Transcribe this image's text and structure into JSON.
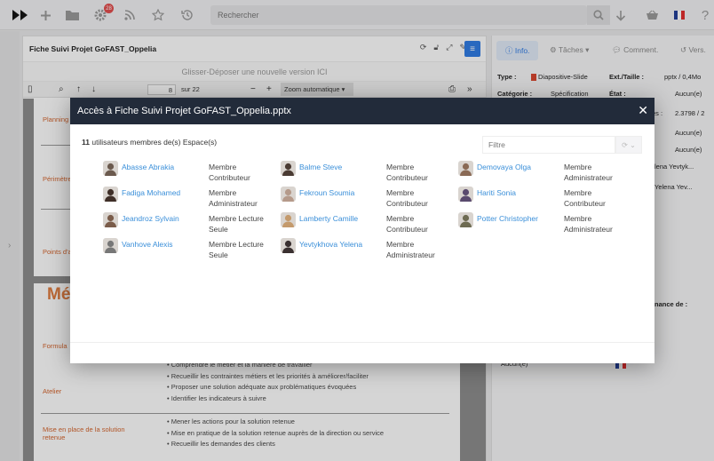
{
  "toolbar": {
    "search_placeholder": "Rechercher",
    "notification_count": "28",
    "flag_colors": [
      "#1f3c96",
      "#ffffff",
      "#e22b2b"
    ]
  },
  "document": {
    "title": "Fiche Suivi Projet GoFAST_Oppelia",
    "dropzone": "Glisser-Déposer une nouvelle version ICI",
    "pdf_page": "8",
    "pdf_of": "sur 22",
    "zoom": "Zoom automatique",
    "slide1_labels": [
      "Planning",
      "Périmètre",
      "Points d'a"
    ],
    "slide2_heading": "Mét",
    "slide2_labels": [
      "Formula",
      "Atelier",
      "Mise en place de la solution retenue"
    ],
    "bullets_atelier": [
      "Comprendre le métier et la manière de travailler",
      "Recueillir les contraintes métiers et les priorités à améliorer/faciliter",
      "Proposer une solution adéquate aux problématiques évoquées",
      "Identifier les indicateurs à suivre"
    ],
    "bullets_solution": [
      "Mener les actions pour la solution retenue",
      "Mise en pratique de la solution retenue auprès de la direction ou service",
      "Recueillir les demandes des clients"
    ]
  },
  "sidebar": {
    "tabs": [
      "Info.",
      "Tâches",
      "Comment.",
      "Vers."
    ],
    "type_label": "Type :",
    "type_value": "Diapositive-Slide",
    "ext_label": "Ext./Taille :",
    "ext_value": "pptx / 0,4Mo",
    "cat_label": "Catégorie :",
    "cat_value": "Spécification",
    "state_label": "État :",
    "state_value": "Aucun(e)",
    "version_suffix": "es :",
    "version_value": "2.3798 / 2",
    "aucun_values": [
      "Aucun(e)",
      "Aucun(e)"
    ],
    "user_snippets": [
      "lena Yevtyk...",
      "Yelena Yev..."
    ],
    "maintenance_label": "nance de :",
    "bottom_value": "Aucun(e)"
  },
  "modal": {
    "title": "Accès à Fiche Suivi Projet GoFAST_Oppelia.pptx",
    "count": "11",
    "count_text": "utilisateurs membres de(s) Espace(s)",
    "filter_placeholder": "Filtre",
    "members": [
      {
        "name": "Abasse Abrakia",
        "role": "Membre Contributeur",
        "avatar_color": "#6b5a4e"
      },
      {
        "name": "Balme Steve",
        "role": "Membre Contributeur",
        "avatar_color": "#4a3b33"
      },
      {
        "name": "Demovaya Olga",
        "role": "Membre Administrateur",
        "avatar_color": "#8a6a55"
      },
      {
        "name": "Fadiga Mohamed",
        "role": "Membre Administrateur",
        "avatar_color": "#3f2f28"
      },
      {
        "name": "Fekroun Soumia",
        "role": "Membre Contributeur",
        "avatar_color": "#b59a8a"
      },
      {
        "name": "Hariti Sonia",
        "role": "Membre Contributeur",
        "avatar_color": "#5a4a6e"
      },
      {
        "name": "Jeandroz Sylvain",
        "role": "Membre Lecture Seule",
        "avatar_color": "#7a5c4a"
      },
      {
        "name": "Lamberty Camille",
        "role": "Membre Contributeur",
        "avatar_color": "#c49a6c"
      },
      {
        "name": "Potter Christopher",
        "role": "Membre Administrateur",
        "avatar_color": "#6e6b52"
      },
      {
        "name": "Vanhove Alexis",
        "role": "Membre Lecture Seule",
        "avatar_color": "#777777"
      },
      {
        "name": "Yevtykhova Yelena",
        "role": "Membre Administrateur",
        "avatar_color": "#3a3030"
      }
    ]
  }
}
